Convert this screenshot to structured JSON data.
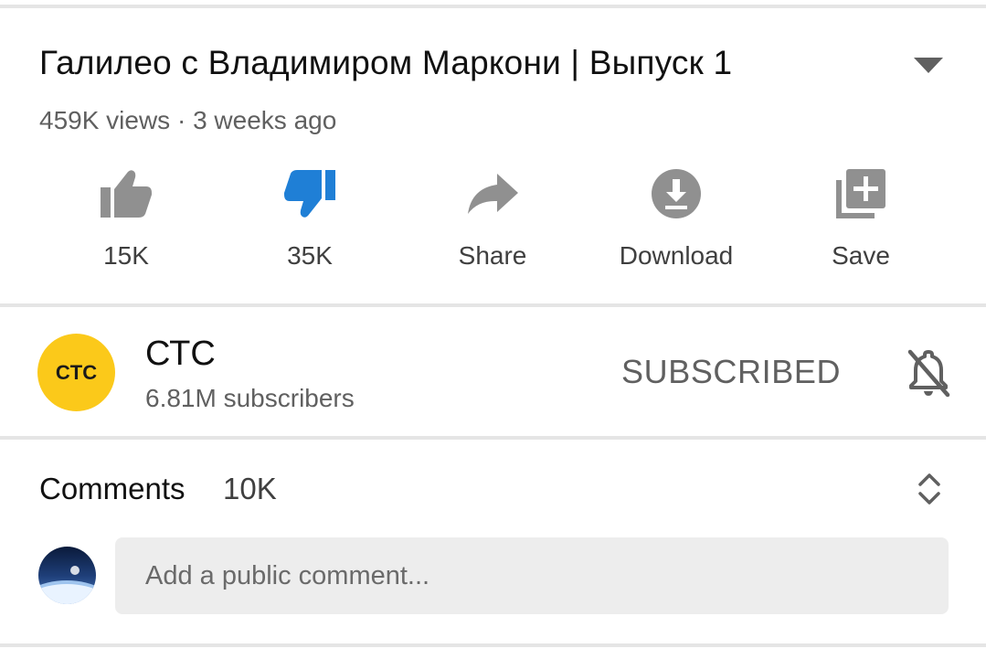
{
  "video": {
    "title": "Галилео с Владимиром Маркони | Выпуск 1",
    "meta": "459K views · 3 weeks ago"
  },
  "actions": {
    "like": {
      "label": "15K",
      "icon": "thumb-up-icon",
      "active": false
    },
    "dislike": {
      "label": "35K",
      "icon": "thumb-down-icon",
      "active": true
    },
    "share": {
      "label": "Share",
      "icon": "share-arrow-icon"
    },
    "download": {
      "label": "Download",
      "icon": "download-icon"
    },
    "save": {
      "label": "Save",
      "icon": "playlist-add-icon"
    }
  },
  "channel": {
    "logo_text": "CTC",
    "name": "СТС",
    "subscribers": "6.81M subscribers",
    "subscribe_label": "SUBSCRIBED",
    "bell_icon": "bell-off-icon"
  },
  "comments": {
    "title": "Comments",
    "count": "10K",
    "input_placeholder": "Add a public comment..."
  },
  "colors": {
    "accent_blue": "#1f7fd6",
    "icon_gray": "#909090",
    "channel_yellow": "#fbc91a",
    "divider": "#e5e5e5"
  }
}
